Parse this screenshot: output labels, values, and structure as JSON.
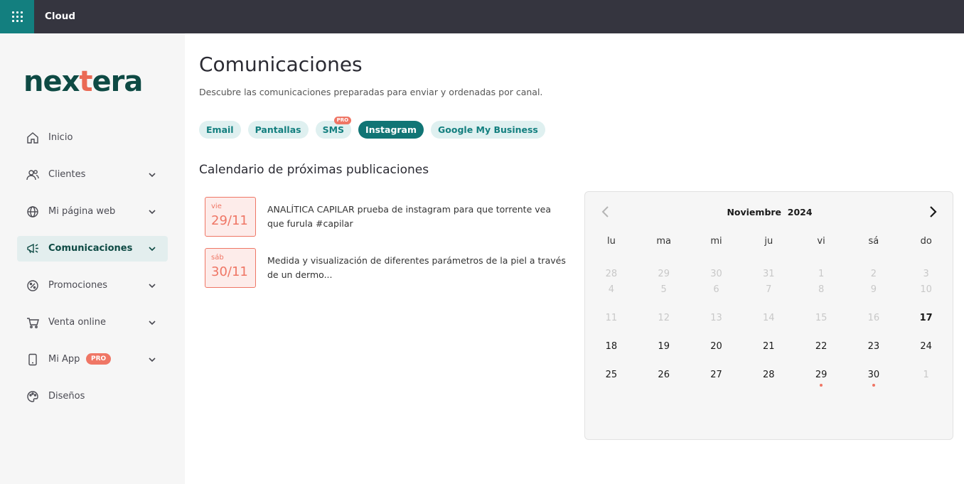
{
  "app": {
    "title": "Cloud"
  },
  "brand": {
    "logo_text_a": "nex",
    "logo_text_cross": "t",
    "logo_text_b": "era",
    "accent": "#137f7f",
    "brand_dark": "#0e4a44",
    "coral": "#ef7665"
  },
  "sidebar": {
    "items": [
      {
        "label": "Inicio",
        "icon": "home-icon"
      },
      {
        "label": "Clientes",
        "icon": "users-icon"
      },
      {
        "label": "Mi página web",
        "icon": "globe-icon"
      },
      {
        "label": "Comunicaciones",
        "icon": "megaphone-icon",
        "active": true
      },
      {
        "label": "Promociones",
        "icon": "discount-icon"
      },
      {
        "label": "Venta online",
        "icon": "cart-icon"
      },
      {
        "label": "Mi App",
        "icon": "phone-icon",
        "badge": "PRO"
      },
      {
        "label": "Diseños",
        "icon": "palette-icon"
      }
    ]
  },
  "main": {
    "title": "Comunicaciones",
    "subtitle": "Descubre las comunicaciones preparadas para enviar y ordenadas por canal.",
    "tabs": [
      {
        "label": "Email"
      },
      {
        "label": "Pantallas"
      },
      {
        "label": "SMS",
        "badge": "PRO"
      },
      {
        "label": "Instagram",
        "active": true
      },
      {
        "label": "Google My Business"
      }
    ],
    "section_title": "Calendario de próximas publicaciones",
    "posts": [
      {
        "dow": "vie",
        "date": "29/11",
        "text": "ANALÍTICA CAPILAR prueba de instagram para que torrente vea que furula #capilar"
      },
      {
        "dow": "sáb",
        "date": "30/11",
        "text": "Medida y visualización de diferentes parámetros de la piel a través de un dermo..."
      }
    ]
  },
  "calendar": {
    "month": "Noviembre",
    "year": "2024",
    "weekdays": [
      "lu",
      "ma",
      "mi",
      "ju",
      "vi",
      "sá",
      "do"
    ],
    "weeks": [
      [
        "28",
        "29",
        "30",
        "31",
        "1",
        "2",
        "3"
      ],
      [
        "4",
        "5",
        "6",
        "7",
        "8",
        "9",
        "10"
      ],
      [
        "11",
        "12",
        "13",
        "14",
        "15",
        "16",
        "17"
      ],
      [
        "18",
        "19",
        "20",
        "21",
        "22",
        "23",
        "24"
      ],
      [
        "25",
        "26",
        "27",
        "28",
        "29",
        "30",
        "1"
      ]
    ],
    "today": "17",
    "event_days": [
      "29",
      "30"
    ]
  }
}
